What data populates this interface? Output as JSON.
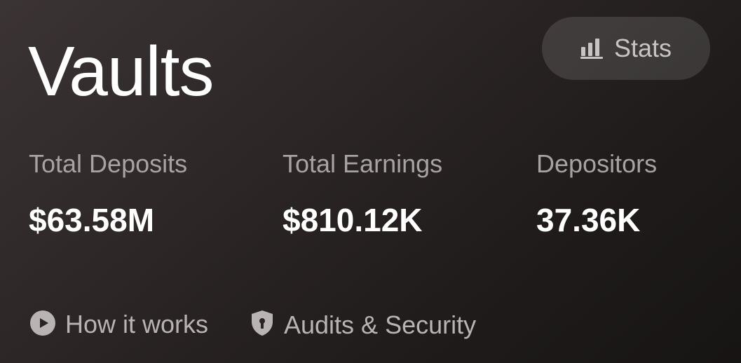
{
  "header": {
    "title": "Vaults",
    "stats_button": {
      "label": "Stats",
      "icon": "bar-chart-icon"
    }
  },
  "metrics": [
    {
      "label": "Total Deposits",
      "value": "$63.58M"
    },
    {
      "label": "Total Earnings",
      "value": "$810.12K"
    },
    {
      "label": "Depositors",
      "value": "37.36K"
    }
  ],
  "links": [
    {
      "label": "How it works",
      "icon": "play-circle-icon"
    },
    {
      "label": "Audits & Security",
      "icon": "shield-icon"
    }
  ],
  "colors": {
    "background": "#2c2626",
    "title": "#ffffff",
    "label": "#a8a3a3",
    "value": "#ffffff",
    "button_bg": "rgba(255,255,255,0.12)"
  }
}
